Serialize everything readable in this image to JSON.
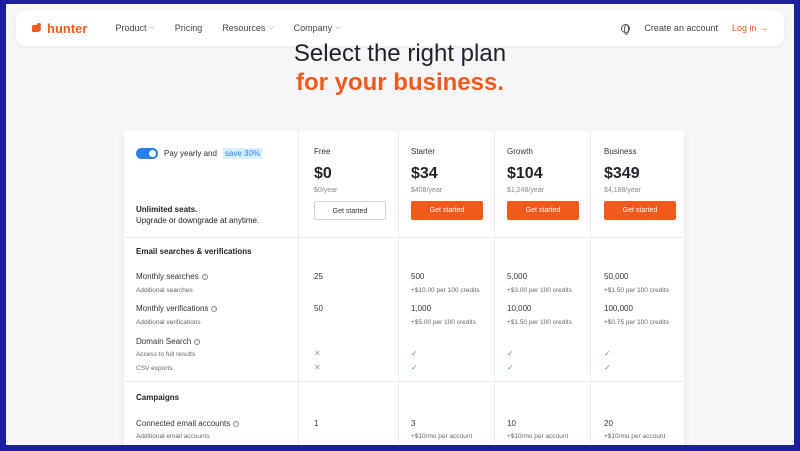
{
  "nav": {
    "brand": "hunter",
    "items": [
      {
        "label": "Product",
        "chevron": true
      },
      {
        "label": "Pricing",
        "chevron": false
      },
      {
        "label": "Resources",
        "chevron": true
      },
      {
        "label": "Company",
        "chevron": true
      }
    ],
    "create_account": "Create an account",
    "login": "Log in →"
  },
  "hero": {
    "title": "Select the right plan",
    "subtitle": "for your business."
  },
  "billing": {
    "toggle_label": "Pay yearly and",
    "save_label": "save 30%",
    "unlimited_title": "Unlimited seats.",
    "unlimited_sub": "Upgrade or downgrade at anytime."
  },
  "plans": [
    {
      "name": "Free",
      "price": "$0",
      "yearly": "$0/year",
      "cta": "Get started"
    },
    {
      "name": "Starter",
      "price": "$34",
      "yearly": "$408/year",
      "cta": "Get started"
    },
    {
      "name": "Growth",
      "price": "$104",
      "yearly": "$1,248/year",
      "cta": "Get started"
    },
    {
      "name": "Business",
      "price": "$349",
      "yearly": "$4,188/year",
      "cta": "Get started"
    }
  ],
  "sections": {
    "email": "Email searches & verifications",
    "campaigns": "Campaigns"
  },
  "rows": {
    "monthly_searches": {
      "label": "Monthly searches",
      "sub": "Additional searches",
      "values": [
        "25",
        "500",
        "5,000",
        "50,000"
      ],
      "subvalues": [
        "",
        "+$10.00 per 100 credits",
        "+$3.00 per 100 credits",
        "+$1.50 per 100 credits"
      ]
    },
    "monthly_verifications": {
      "label": "Monthly verifications",
      "sub": "Additional verifications",
      "values": [
        "50",
        "1,000",
        "10,000",
        "100,000"
      ],
      "subvalues": [
        "",
        "+$5.00 per 100 credits",
        "+$1.50 per 100 credits",
        "+$0.75 per 100 credits"
      ]
    },
    "domain_search": {
      "label": "Domain Search",
      "sub1": "Access to full results",
      "sub2": "CSV exports"
    },
    "connected": {
      "label": "Connected email accounts",
      "sub": "Additional email accounts",
      "values": [
        "1",
        "3",
        "10",
        "20"
      ],
      "subvalues": [
        "",
        "+$10/mo per account",
        "+$10/mo per account",
        "+$10/mo per account"
      ]
    }
  },
  "colors": {
    "accent": "#f25a1c",
    "toggle": "#2b7de9",
    "check": "#3fb27f",
    "border": "#1b1fa0"
  }
}
